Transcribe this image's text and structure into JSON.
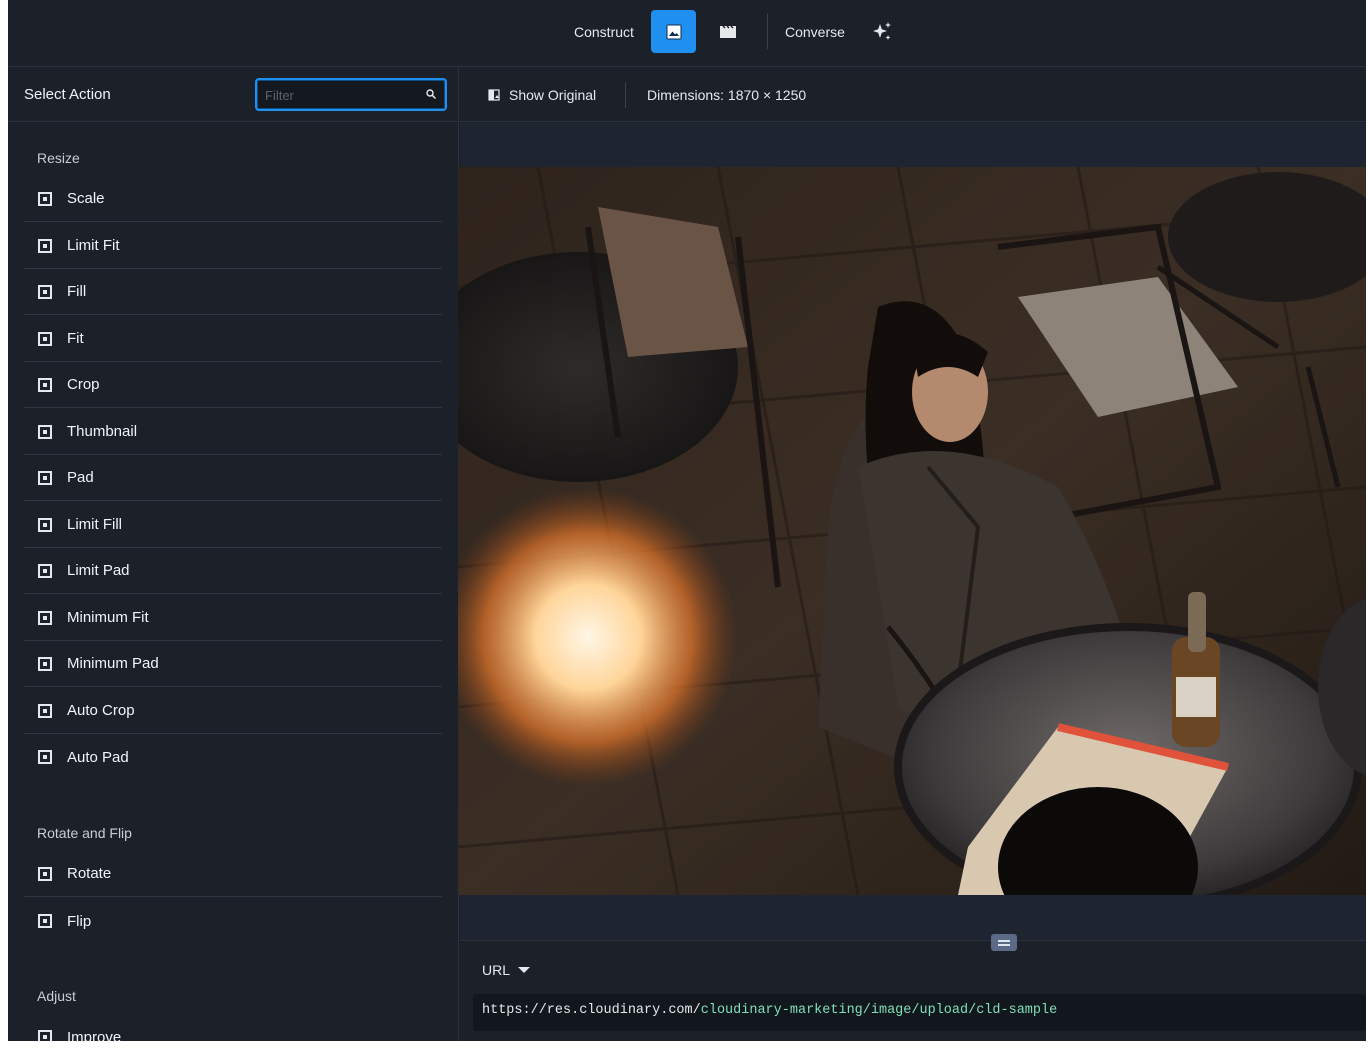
{
  "topbar": {
    "construct_label": "Construct",
    "converse_label": "Converse",
    "image_mode_icon": "image-icon",
    "video_mode_icon": "video-clapper-icon",
    "ai_icon": "sparkles-icon",
    "accent_color": "#1f8ff0"
  },
  "sidebar": {
    "title": "Select Action",
    "filter": {
      "placeholder": "Filter",
      "value": ""
    },
    "sections": [
      {
        "title": "Resize",
        "items": [
          "Scale",
          "Limit Fit",
          "Fill",
          "Fit",
          "Crop",
          "Thumbnail",
          "Pad",
          "Limit Fill",
          "Limit Pad",
          "Minimum Fit",
          "Minimum Pad",
          "Auto Crop",
          "Auto Pad"
        ]
      },
      {
        "title": "Rotate and Flip",
        "items": [
          "Rotate",
          "Flip"
        ]
      },
      {
        "title": "Adjust",
        "items": [
          "Improve"
        ]
      }
    ]
  },
  "main": {
    "show_original_label": "Show Original",
    "dimensions_label": "Dimensions: 1870 × 1250",
    "url": {
      "format_label": "URL",
      "base": "https://res.cloudinary.com/",
      "path": "cloudinary-marketing/image/upload/cld-sample"
    }
  }
}
